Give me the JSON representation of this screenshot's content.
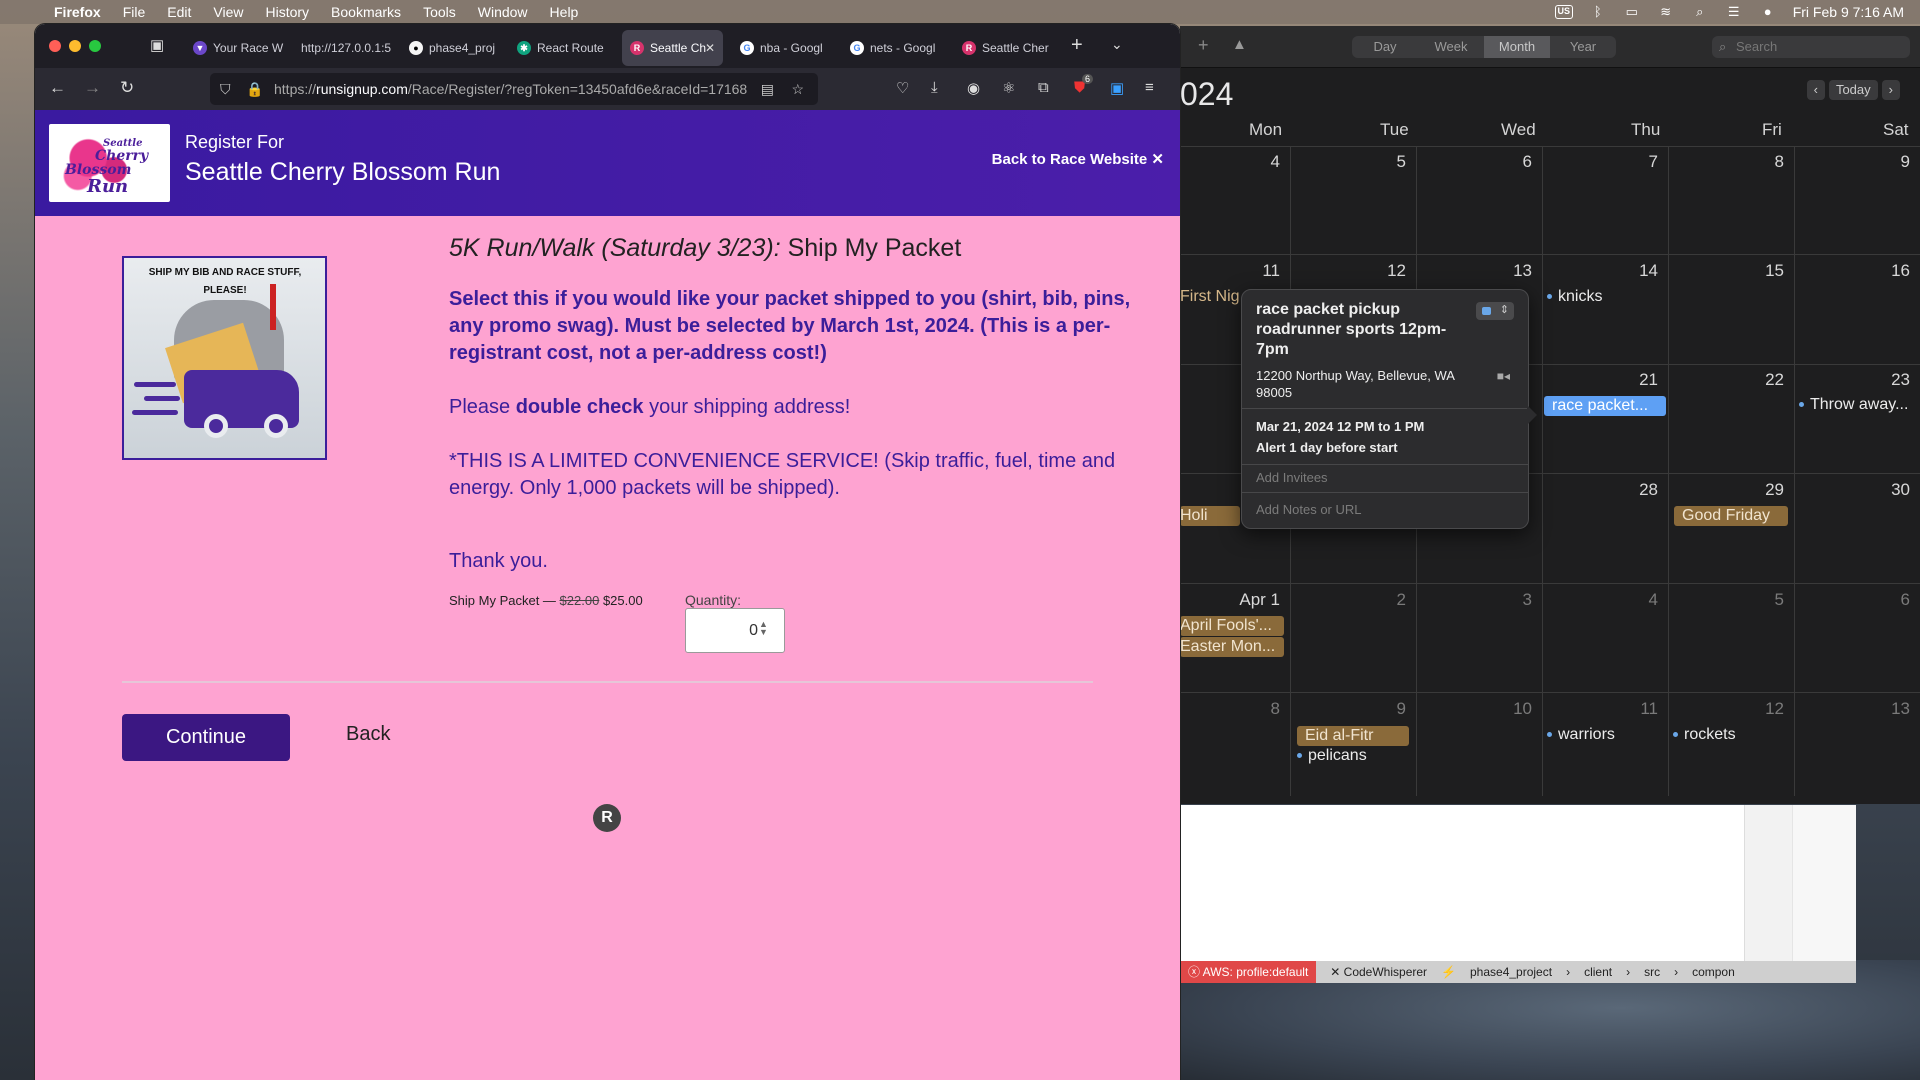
{
  "menubar": {
    "app": "Firefox",
    "items": [
      "File",
      "Edit",
      "View",
      "History",
      "Bookmarks",
      "Tools",
      "Window",
      "Help"
    ],
    "input_source": "US",
    "datetime": "Fri Feb 9  7:16 AM"
  },
  "browser": {
    "tabs": [
      {
        "label": "Your Race W",
        "icon": "vercel-icon"
      },
      {
        "label": "http://127.0.0.1:5",
        "icon": "none"
      },
      {
        "label": "phase4_proj",
        "icon": "github-icon"
      },
      {
        "label": "React Route",
        "icon": "chatgpt-icon"
      },
      {
        "label": "Seattle Ch",
        "icon": "runsignup-icon",
        "active": true
      },
      {
        "label": "nba - Googl",
        "icon": "google-icon"
      },
      {
        "label": "nets - Googl",
        "icon": "google-icon"
      },
      {
        "label": "Seattle Cher",
        "icon": "runsignup-icon"
      }
    ],
    "url_prefix": "https://",
    "url_domain": "runsignup.com",
    "url_path": "/Race/Register/?regToken=13450afd6e&raceId=17168",
    "extension_badge": "6"
  },
  "page": {
    "register_for": "Register For",
    "race_name": "Seattle Cherry Blossom Run",
    "back_to_site": "Back to Race Website ✕",
    "logo": {
      "line1": "Seattle",
      "line2": "Cherry",
      "line3": "Blossom",
      "line4": "Run"
    },
    "image_caption": "SHIP MY BIB AND RACE STUFF, PLEASE!",
    "event_name": "5K Run/Walk (Saturday 3/23):",
    "addon_name": "Ship My Packet",
    "desc_bold": "Select this if you would like your packet shipped to you (shirt, bib, pins, any promo swag). Must be selected by March 1st, 2024.  (This is a per-registrant cost, not a per-address cost!)",
    "double_check_pre": "Please ",
    "double_check_bold": "double check",
    "double_check_post": " your shipping address!",
    "limited": "*THIS IS A LIMITED CONVENIENCE SERVICE! (Skip traffic, fuel, time and energy. Only 1,000 packets will be shipped).",
    "thanks": "Thank you.",
    "price_label": "Ship My Packet — ",
    "old_price": "$22.00",
    "new_price": "$25.00",
    "quantity_label": "Quantity:",
    "quantity_value": "0",
    "continue_label": "Continue",
    "back_label": "Back",
    "footer_logo": "R"
  },
  "calendar": {
    "views": [
      "Day",
      "Week",
      "Month",
      "Year"
    ],
    "active_view": "Month",
    "search_placeholder": "Search",
    "year_partial": "024",
    "today_label": "Today",
    "weekdays": [
      "Mon",
      "Tue",
      "Wed",
      "Thu",
      "Fri",
      "Sat"
    ],
    "weeks": [
      [
        "4",
        "5",
        "6",
        "7",
        "8",
        "9"
      ],
      [
        "11",
        "12",
        "13",
        "14",
        "15",
        "16"
      ],
      [
        "",
        "",
        "",
        "21",
        "22",
        "23"
      ],
      [
        "",
        "",
        "",
        "28",
        "29",
        "30"
      ],
      [
        "Apr 1",
        "2",
        "3",
        "4",
        "5",
        "6"
      ],
      [
        "8",
        "9",
        "10",
        "11",
        "12",
        "13"
      ]
    ],
    "events": {
      "first_night": "First Nig",
      "knicks": "knicks",
      "race_packet": "race packet...",
      "throw_away": "Throw away...",
      "holi": "Holi",
      "good_friday": "Good Friday",
      "april_fools": "April Fools'...",
      "easter": "Easter Mon...",
      "eid": "Eid al-Fitr",
      "pelicans": "pelicans",
      "warriors": "warriors",
      "rockets": "rockets"
    },
    "popover": {
      "title": "race packet pickup roadrunner sports 12pm-7pm",
      "address": "12200 Northup Way, Bellevue, WA 98005",
      "when": "Mar 21, 2024  12 PM to 1 PM",
      "alert": "Alert 1 day before start",
      "invitees_placeholder": "Add Invitees",
      "notes_placeholder": "Add Notes or URL"
    }
  },
  "editor_status": {
    "aws": "ⓧ AWS: profile:default",
    "codewhisperer": "✕ CodeWhisperer",
    "project": "phase4_project",
    "crumbs": [
      "client",
      "src",
      "compon"
    ]
  }
}
